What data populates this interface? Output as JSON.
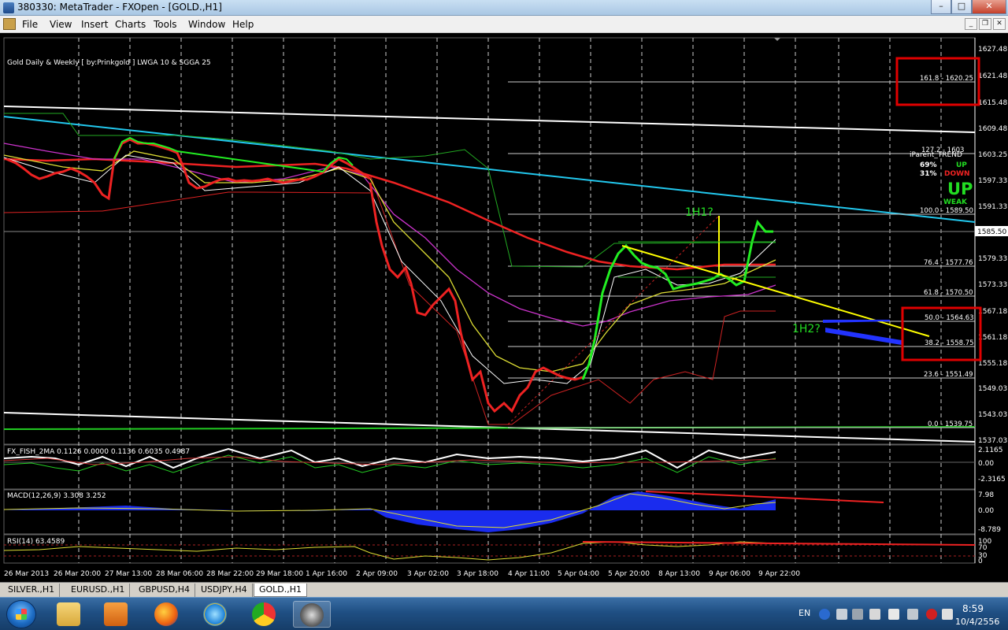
{
  "window": {
    "title": "380330: MetaTrader - FXOpen - [GOLD.,H1]"
  },
  "menu": [
    "File",
    "View",
    "Insert",
    "Charts",
    "Tools",
    "Window",
    "Help"
  ],
  "chart": {
    "header": "Gold Daily & Weekly [ by:Prinkgold ]  LWGA 10  &  SGGA 25",
    "price_axis": [
      "1627.48",
      "1621.48",
      "1615.48",
      "1609.48",
      "1603.25",
      "1597.33",
      "1591.33",
      "1585.50",
      "1579.33",
      "1573.33",
      "1567.18",
      "1561.18",
      "1555.18",
      "1549.03",
      "1543.03",
      "1537.03"
    ],
    "current_price": "1585.50",
    "fib_levels": [
      {
        "label": "161.8 - 1620.25"
      },
      {
        "label": "100.0 - 1589.50"
      },
      {
        "label": "76.4 - 1577.76"
      },
      {
        "label": "61.8 - 1570.50"
      },
      {
        "label": "50.0 - 1564.63"
      },
      {
        "label": "38.2 - 1558.75"
      },
      {
        "label": "23.6 - 1551.49"
      },
      {
        "label": "0.0 - 1539.75"
      }
    ],
    "fib_top_partial": "127.2 - 1603",
    "trend_panel": {
      "title": "iParent_TREND",
      "pct_up": "69%",
      "pct_down": "31%",
      "up": "UP",
      "down": "DOWN",
      "big": "UP",
      "strength": "WEAK"
    },
    "annotations": {
      "h1": "1H1?",
      "h2": "1H2?"
    },
    "time_axis": [
      "26 Mar 2013",
      "26 Mar 20:00",
      "27 Mar 13:00",
      "28 Mar 06:00",
      "28 Mar 22:00",
      "29 Mar 18:00",
      "1 Apr 16:00",
      "2 Apr 09:00",
      "3 Apr 02:00",
      "3 Apr 18:00",
      "4 Apr 11:00",
      "5 Apr 04:00",
      "5 Apr 20:00",
      "8 Apr 13:00",
      "9 Apr 06:00",
      "9 Apr 22:00"
    ]
  },
  "indicators": {
    "fish": {
      "label": "FX_FISH_2MA 0.1126 0.0000 0.1136 0.6035 0.4987",
      "axis": [
        "2.1165",
        "0.00",
        "-2.3165"
      ]
    },
    "macd": {
      "label": "MACD(12,26,9) 3.308 3.252",
      "axis": [
        "7.98",
        "0.00",
        "-8.789"
      ]
    },
    "rsi": {
      "label": "RSI(14) 63.4589",
      "axis": [
        "100",
        "70",
        "30",
        "0"
      ]
    }
  },
  "tabs": [
    "SILVER.,H1",
    "EURUSD.,H1",
    "GBPUSD,H4",
    "USDJPY,H4",
    "GOLD.,H1"
  ],
  "active_tab": "GOLD.,H1",
  "taskbar": {
    "lang": "EN",
    "time": "8:59",
    "date": "10/4/2556"
  },
  "colors": {
    "bull": "#00ff00",
    "bear": "#ff0000",
    "trendline": "#ffff00",
    "cyan": "#00c8ff",
    "box": "#e00000"
  }
}
